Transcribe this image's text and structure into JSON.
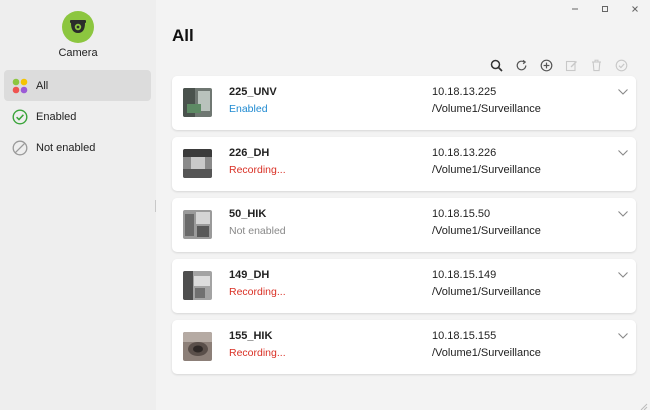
{
  "app": {
    "name": "Camera",
    "logo_color": "#8cc63f"
  },
  "window": {
    "controls": [
      "minimize-icon",
      "maximize-icon",
      "close-icon"
    ]
  },
  "sidebar": {
    "items": [
      {
        "label": "All",
        "icon": "grid-icon",
        "active": true
      },
      {
        "label": "Enabled",
        "icon": "check-circle-icon",
        "active": false
      },
      {
        "label": "Not enabled",
        "icon": "disabled-circle-icon",
        "active": false
      }
    ]
  },
  "main": {
    "title": "All"
  },
  "toolbar": [
    "search-icon",
    "refresh-icon",
    "add-icon",
    "edit-icon",
    "delete-icon",
    "check-icon"
  ],
  "colors": {
    "enabled": "#1f8ad1",
    "recording": "#d93025",
    "not_enabled": "#888888",
    "accent_green": "#3aa43a"
  },
  "cameras": [
    {
      "name": "225_UNV",
      "status": "Enabled",
      "status_type": "enabled",
      "ip": "10.18.13.225",
      "path": "/Volume1/Surveillance"
    },
    {
      "name": "226_DH",
      "status": "Recording...",
      "status_type": "recording",
      "ip": "10.18.13.226",
      "path": "/Volume1/Surveillance"
    },
    {
      "name": "50_HIK",
      "status": "Not enabled",
      "status_type": "not_enabled",
      "ip": "10.18.15.50",
      "path": "/Volume1/Surveillance"
    },
    {
      "name": "149_DH",
      "status": "Recording...",
      "status_type": "recording",
      "ip": "10.18.15.149",
      "path": "/Volume1/Surveillance"
    },
    {
      "name": "155_HIK",
      "status": "Recording...",
      "status_type": "recording",
      "ip": "10.18.15.155",
      "path": "/Volume1/Surveillance"
    }
  ]
}
